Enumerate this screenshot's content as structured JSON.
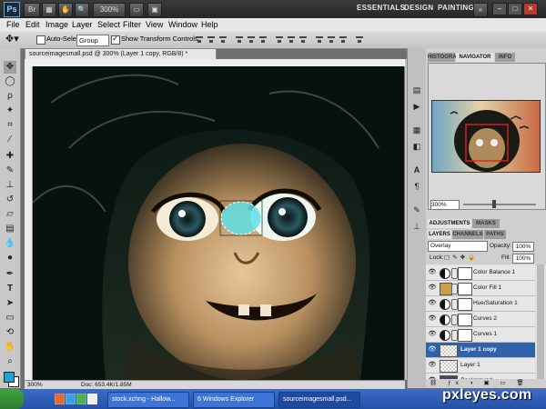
{
  "app": {
    "logo": "Ps",
    "zoom": "300%",
    "workspaces": [
      "ESSENTIALS",
      "DESIGN",
      "PAINTING"
    ],
    "more_workspaces": "»"
  },
  "menu": [
    "File",
    "Edit",
    "Image",
    "Layer",
    "Select",
    "Filter",
    "View",
    "Window",
    "Help"
  ],
  "options": {
    "auto_select_label": "Auto-Select:",
    "auto_select_value": "Group",
    "show_transform_label": "Show Transform Controls"
  },
  "document": {
    "tab_title": "sourceimagesmall.psd @ 300% (Layer 1 copy, RGB/8) *",
    "status_zoom": "300%",
    "status_doc": "Doc: 653.4K/1.85M"
  },
  "panels": {
    "top_tabs": [
      "HISTOGRAM",
      "NAVIGATOR",
      "INFO"
    ],
    "active_top_tab": "NAVIGATOR",
    "navigator_zoom": "300%",
    "adj_tabs": [
      "ADJUSTMENTS",
      "MASKS"
    ],
    "layer_tabs": [
      "LAYERS",
      "CHANNELS",
      "PATHS"
    ]
  },
  "layers": {
    "blend_mode": "Overlay",
    "opacity_label": "Opacity:",
    "opacity_value": "100%",
    "lock_label": "Lock:",
    "fill_label": "Fill:",
    "fill_value": "100%",
    "items": [
      {
        "name": "Color Balance 1",
        "kind": "adjustment"
      },
      {
        "name": "Color Fill 1",
        "kind": "fill",
        "color": "#c8a04a"
      },
      {
        "name": "Hue/Saturation 1",
        "kind": "adjustment"
      },
      {
        "name": "Curves 2",
        "kind": "adjustment"
      },
      {
        "name": "Curves 1",
        "kind": "adjustment"
      },
      {
        "name": "Layer 1 copy",
        "kind": "pixel",
        "selected": true
      },
      {
        "name": "Layer 1",
        "kind": "pixel"
      },
      {
        "name": "Background",
        "kind": "image"
      }
    ]
  },
  "taskbar": {
    "tasks": [
      "stock.xchng - Hallow...",
      "6 Windows Explorer",
      "sourceimagesmall.psd..."
    ]
  },
  "watermark": "pxleyes.com",
  "colors": {
    "selection_blue": "#3062a9",
    "foreground_swatch": "#1fa3d4",
    "background_swatch": "#ffffff",
    "eye_glow": "#5ee0e6"
  }
}
